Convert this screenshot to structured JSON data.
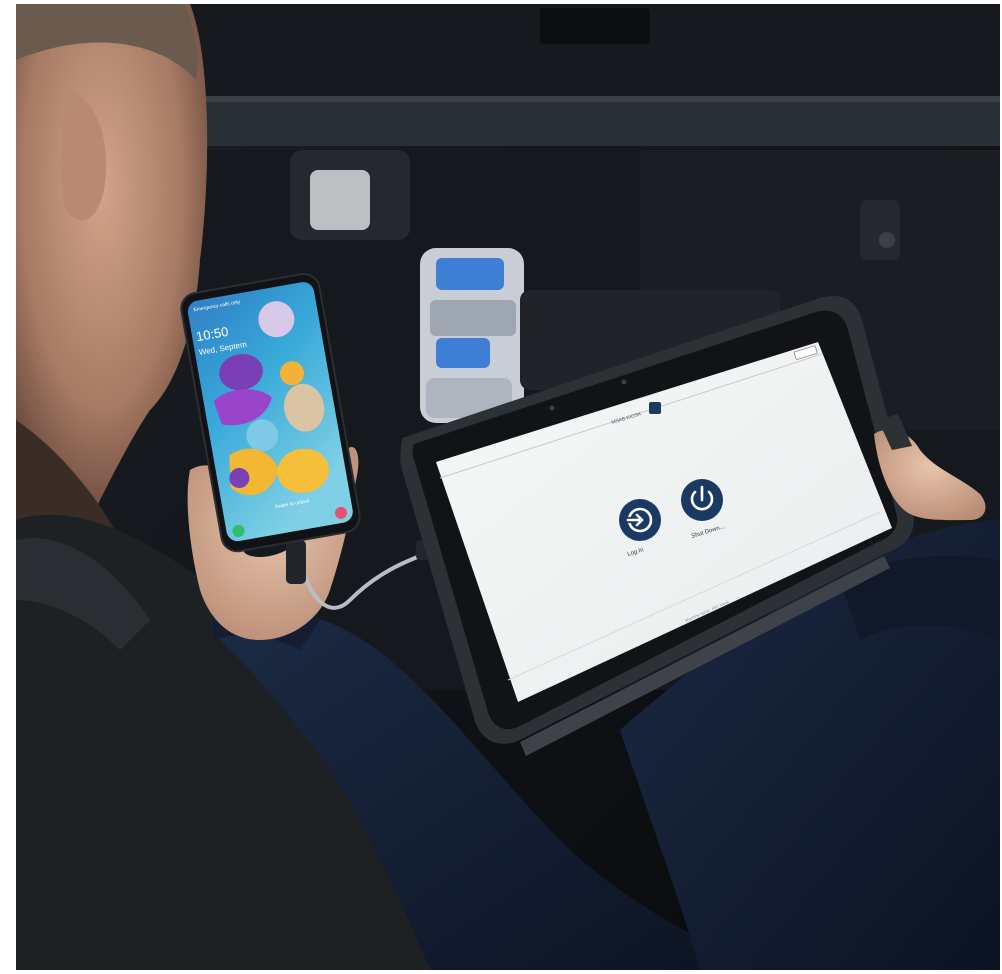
{
  "phone": {
    "time": "10:50",
    "date": "Wed, Septem",
    "status": "Emergency calls only",
    "swipe_hint": "Swipe to unlock"
  },
  "tablet": {
    "header_label": "MSAB KIOSK",
    "login_label": "Log In",
    "shutdown_label": "Shut Down...",
    "footer_text": "Machine name: XRY Kiosk"
  },
  "colors": {
    "kiosk_button": "#1a3a63",
    "screen_bg": "#f3f4f4",
    "wallpaper_top": "#2a7fc0",
    "background": "#0e1013"
  },
  "icons": {
    "login": "login-arrow-icon",
    "shutdown": "power-icon"
  }
}
